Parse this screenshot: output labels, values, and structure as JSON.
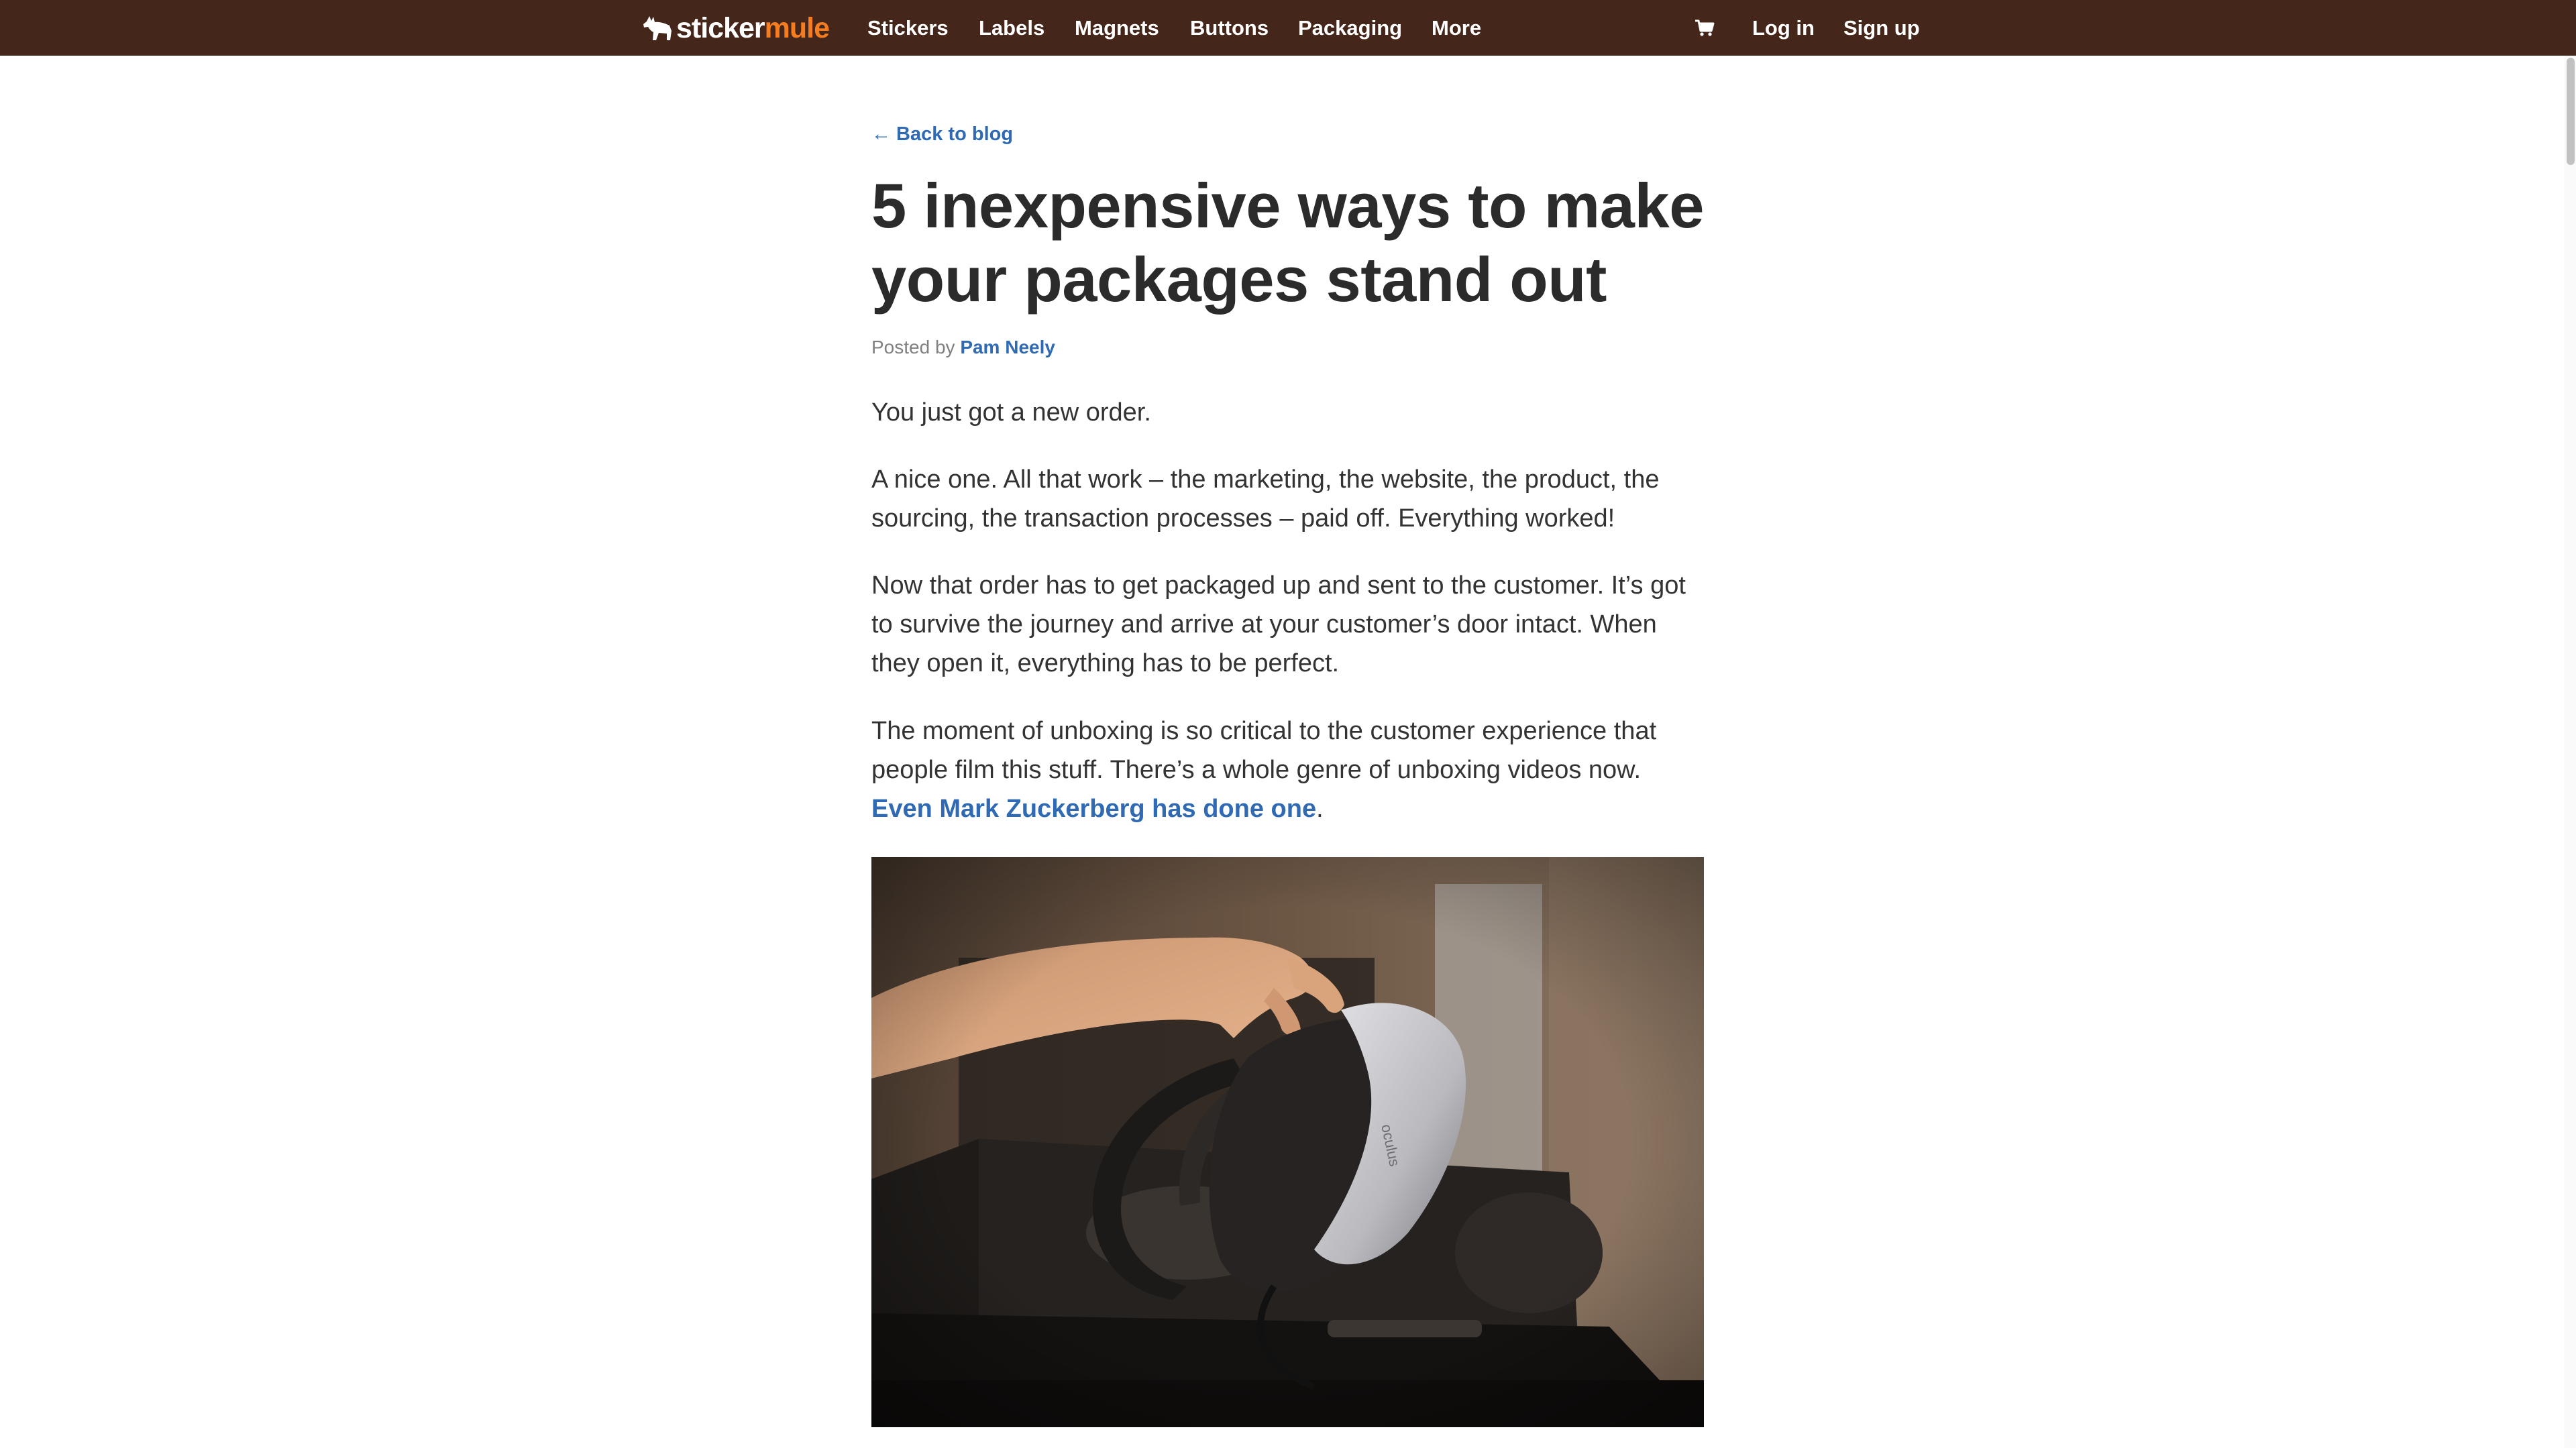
{
  "nav": {
    "logo_part1": "sticker",
    "logo_part2": "mule",
    "links": [
      "Stickers",
      "Labels",
      "Magnets",
      "Buttons",
      "Packaging",
      "More"
    ],
    "login": "Log in",
    "signup": "Sign up",
    "cart_icon": "cart-icon"
  },
  "article": {
    "back_link": "← Back to blog",
    "title": "5 inexpensive ways to make your packages stand out",
    "posted_by_label": "Posted by",
    "author": "Pam Neely",
    "paragraphs": [
      "You just got a new order.",
      "A nice one. All that work – the marketing, the website, the product, the sourcing, the transaction processes – paid off. Everything worked!",
      "Now that order has to get packaged up and sent to the customer. It’s got to survive the journey and arrive at your customer’s door intact. When they open it, everything has to be perfect.",
      "The moment of unboxing is so critical to the customer experience that people film this stuff. There’s a whole genre of unboxing videos now."
    ],
    "para4_link": "Even Mark Zuckerberg has done one",
    "para4_end": ".",
    "image_label": "oculus"
  },
  "colors": {
    "nav_bg": "#45261a",
    "brand_orange": "#f57c1f",
    "link_blue": "#2f6ab3",
    "text": "#333333"
  }
}
